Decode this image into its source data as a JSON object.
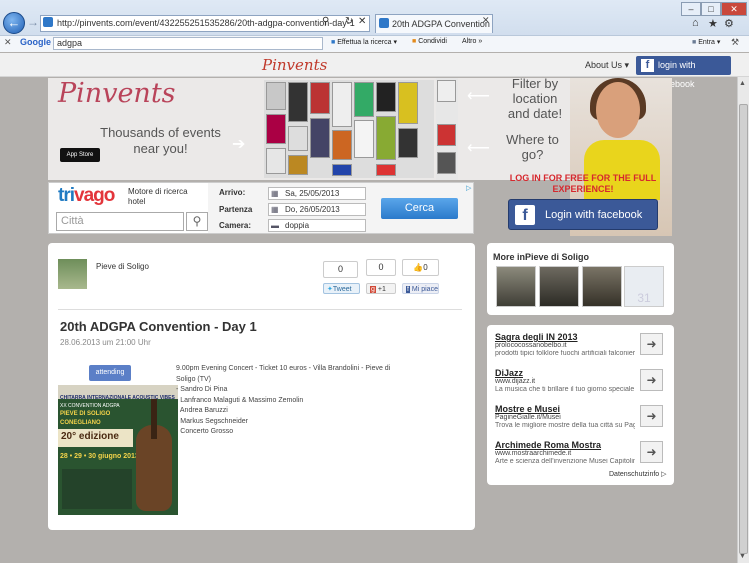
{
  "browser": {
    "url": "http://pinvents.com/event/432255251535286/20th-adgpa-convention-day-1",
    "tab_title": "20th ADGPA Convention - ...",
    "google_label": "Google",
    "google_query": "adgpa",
    "search_btn": "Effettua la ricerca",
    "share_btn": "Condividi",
    "more_btn": "Altro »",
    "signin": "Entra"
  },
  "site": {
    "logo": "Pinvents",
    "about": "About Us",
    "fb_login": "login with facebook"
  },
  "banner": {
    "logo": "Pinvents",
    "tagline": "Thousands of events near you!",
    "appstore": "App Store",
    "filter": "Filter by location and date!",
    "where": "Where to go?",
    "login_free": "LOG IN FOR FREE FOR THE FULL EXPERIENCE!",
    "fb_login": "Login with facebook"
  },
  "trivago": {
    "logo_a": "tri",
    "logo_b": "vago",
    "tagline": "Motore di ricerca hotel",
    "city_placeholder": "Città",
    "arrivo_label": "Arrivo:",
    "arrivo_value": "Sa, 25/05/2013",
    "partenza_label": "Partenza",
    "partenza_value": "Do, 26/05/2013",
    "camera_label": "Camera:",
    "camera_value": "doppia",
    "cerca": "Cerca"
  },
  "event": {
    "place": "Pieve di Soligo",
    "count1": "0",
    "count2": "0",
    "like": "Mi piace",
    "tweet": "Tweet",
    "plus": "+1",
    "title": "20th ADGPA Convention - Day 1",
    "date": "28.06.2013 um 21:00 Uhr",
    "attending": "attending",
    "description": [
      "9.00pm Evening Concert - Ticket 10 euros - Villa Brandolini - Pieve di Soligo (TV)",
      "- Sandro Di Pina",
      "- Lanfranco Malaguti & Massimo Zemolin",
      "- Andrea Baruzzi",
      "- Markus Segschneider",
      "- Concerto Grosso"
    ],
    "poster": {
      "line1": "CHITARRA INTERNAZIONALE ACOUSTIC VIBES",
      "line2": "XX CONVENTION ADGPA",
      "line3": "PIEVE DI SOLIGO",
      "line4": "CONEGLIANO",
      "edition": "20° edizione",
      "dates": "28 • 29 • 30 giugno 2013"
    }
  },
  "more": {
    "title": "More inPieve di Soligo"
  },
  "ads": [
    {
      "title": "Sagra degli IN 2013",
      "url": "prolococossanobelbo.it",
      "desc": "prodotti tipici folklore fuochi artificiali falconieri artigianato"
    },
    {
      "title": "DiJazz",
      "url": "www.dijazz.it",
      "desc": "La musica che ti brillare il tuo giorno speciale"
    },
    {
      "title": "Mostre e Musei",
      "url": "PagineGialle.it/Musei",
      "desc": "Trova le migliore mostre della tua città su PagineGialle!"
    },
    {
      "title": "Archimede Roma Mostra",
      "url": "www.mostraarchimede.it",
      "desc": "Arte e scienza dell'invenzione Musei Capitolini Roma"
    }
  ],
  "datenschutz": "Datenschutzinfo"
}
